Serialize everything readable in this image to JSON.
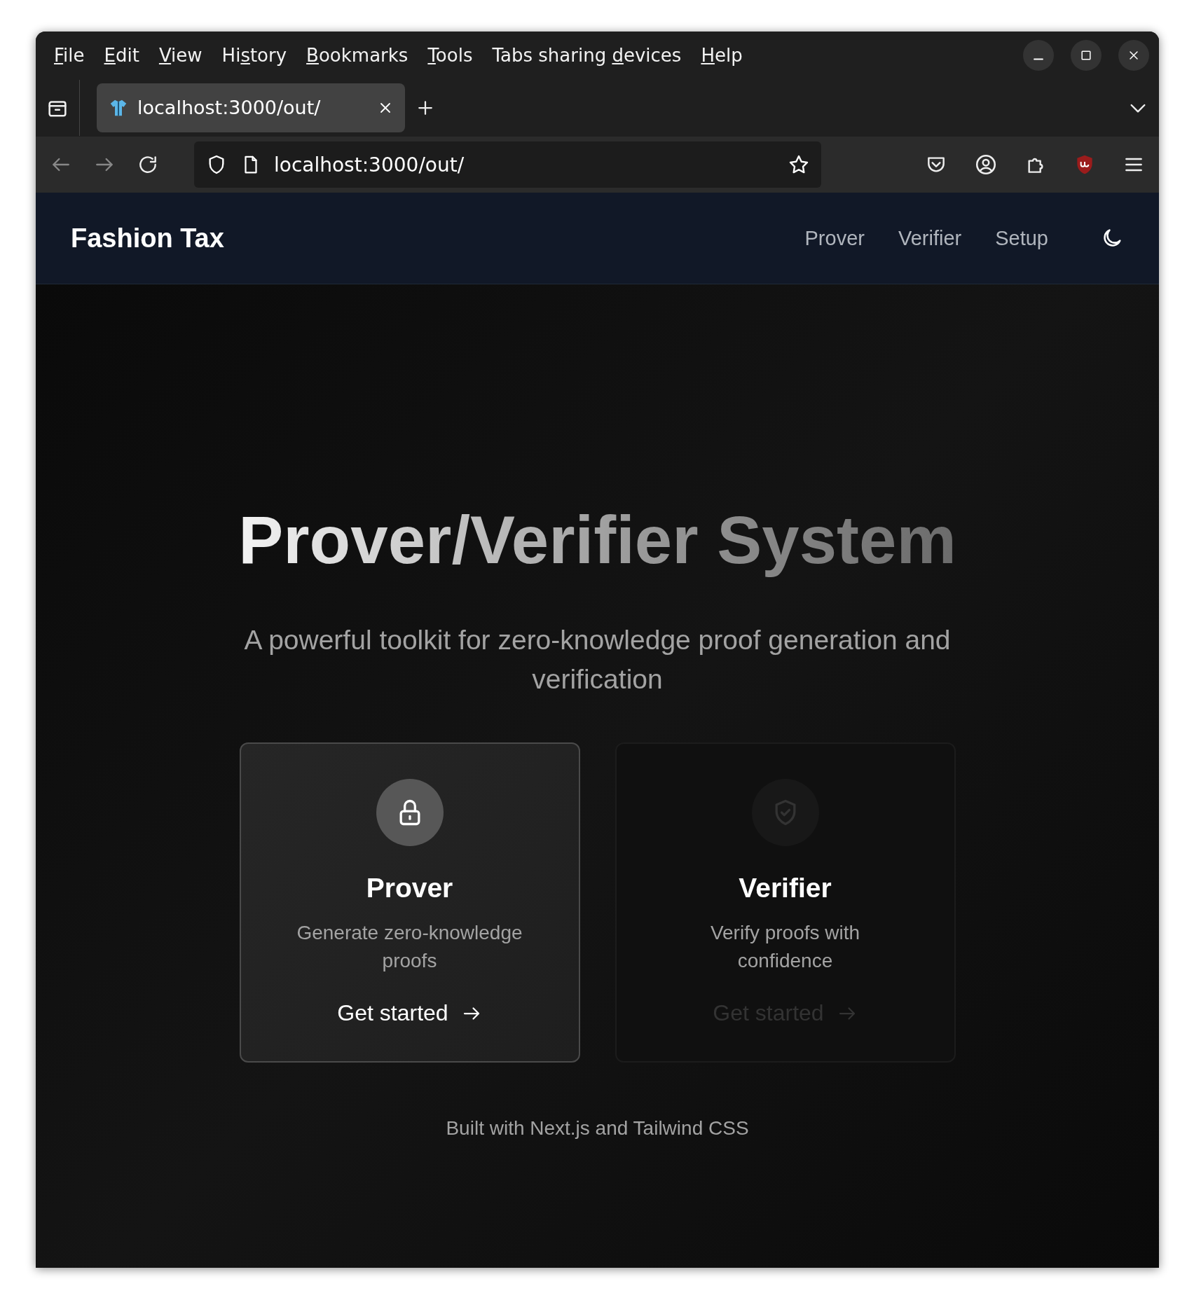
{
  "menu_bar": [
    {
      "key": "F",
      "after": "ile"
    },
    {
      "key": "E",
      "after": "dit"
    },
    {
      "key": "V",
      "after": "iew"
    },
    {
      "before": "Hi",
      "key": "s",
      "after": "tory"
    },
    {
      "key": "B",
      "after": "ookmarks"
    },
    {
      "key": "T",
      "after": "ools"
    },
    {
      "before": "Tabs sharing ",
      "key": "d",
      "after": "evices"
    },
    {
      "key": "H",
      "after": "elp"
    }
  ],
  "tabs": [
    {
      "title": "localhost:3000/out/",
      "selected": true
    }
  ],
  "address_bar": {
    "value": "localhost:3000/out/"
  },
  "site_header": {
    "brand": "Fashion Tax",
    "nav": [
      "Prover",
      "Verifier",
      "Setup"
    ]
  },
  "hero": {
    "title": "Prover/Verifier System",
    "subtitle": "A powerful toolkit for zero-knowledge proof generation and verification"
  },
  "cards": [
    {
      "kind": "lock",
      "title": "Prover",
      "description": "Generate zero-knowledge proofs",
      "action": "Get started",
      "highlighted": true
    },
    {
      "kind": "shield",
      "title": "Verifier",
      "description": "Verify proofs with confidence",
      "action": "Get started",
      "highlighted": false
    }
  ],
  "footer": "Built with Next.js and Tailwind CSS"
}
